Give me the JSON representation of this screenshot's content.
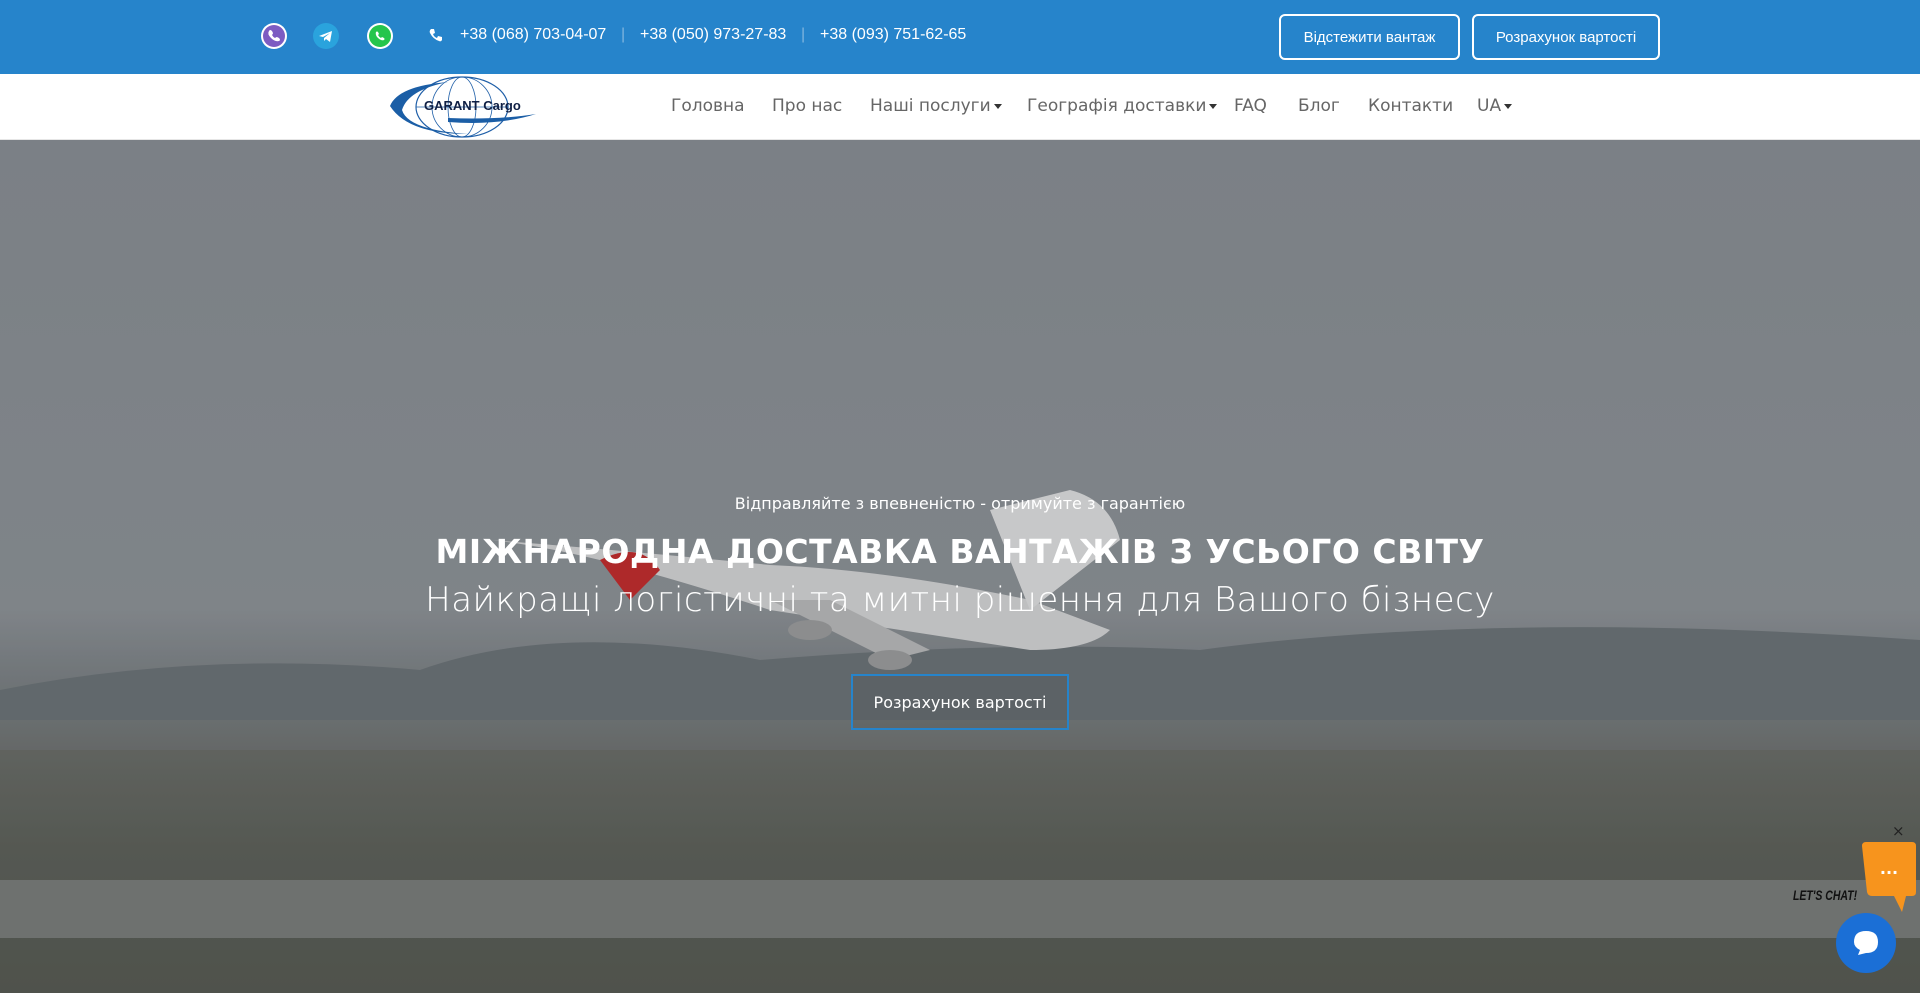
{
  "topbar": {
    "social": [
      {
        "name": "viber-icon",
        "color": "#7d5cc2"
      },
      {
        "name": "telegram-icon",
        "color": "#2aa3dd"
      },
      {
        "name": "whatsapp-icon",
        "color": "#25c54c"
      }
    ],
    "phones": [
      "+38 (068) 703-04-07",
      "+38 (050) 973-27-83",
      "+38 (093) 751-62-65"
    ],
    "separator": "|",
    "track_button": "Відстежити вантаж",
    "calc_button": "Розрахунок вартості"
  },
  "nav": {
    "logo_text": "GARANT Cargo",
    "items": [
      "Головна",
      "Про нас",
      "Наші послуги",
      "Географія доставки",
      "FAQ",
      "Блог",
      "Контакти",
      "UA"
    ]
  },
  "hero": {
    "subtitle": "Відправляйте з впевненістю - отримуйте з гарантією",
    "title": "МІЖНАРОДНА ДОСТАВКА ВАНТАЖІВ З УСЬОГО СВІТУ",
    "tagline": "Найкращі логістичні та митні рішення для Вашого бізнесу",
    "button": "Розрахунок вартості"
  },
  "chat": {
    "close": "×",
    "label": "LET'S CHAT!",
    "bubble_text": "...",
    "accent": "#f7941d",
    "button_color": "#1b6fd6"
  },
  "colors": {
    "brand_blue": "#2684cb"
  }
}
